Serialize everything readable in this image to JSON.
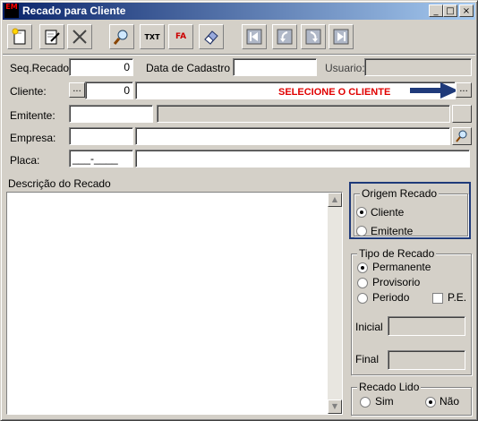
{
  "window": {
    "title": "Recado para Cliente",
    "icon_text": "EM",
    "minimize_label": "_",
    "maximize_label": "□",
    "close_label": "×"
  },
  "toolbar": {
    "icons": [
      "new-icon",
      "edit-icon",
      "delete-icon",
      "search-icon",
      "txt-export-icon",
      "font-icon",
      "erase-icon",
      "first-record-icon",
      "previous-record-icon",
      "next-record-icon",
      "last-record-icon"
    ],
    "txt_label": "TXT",
    "font_label": "FA"
  },
  "form": {
    "seq_label": "Seq.Recado",
    "seq_value": "0",
    "data_cadastro_label": "Data de Cadastro :",
    "data_cadastro_value": "",
    "usuario_label": "Usuario:",
    "usuario_value": "",
    "cliente_label": "Cliente:",
    "cliente_browse": "...",
    "cliente_code": "0",
    "cliente_name": "",
    "cliente_lookup": "...",
    "hint_text": "SELECIONE O CLIENTE",
    "emitente_label": "Emitente:",
    "emitente_code": "",
    "emitente_name": "",
    "empresa_label": "Empresa:",
    "empresa_code": "",
    "empresa_name": "",
    "placa_label": "Placa:",
    "placa_value": "___-____",
    "placa_desc": "",
    "descricao_label": "Descrição do Recado",
    "descricao_value": ""
  },
  "origem": {
    "title": "Origem Recado",
    "options": [
      "Cliente",
      "Emitente"
    ],
    "selected": "Cliente"
  },
  "tipo": {
    "title": "Tipo de Recado",
    "options": [
      "Permanente",
      "Provisorio",
      "Periodo"
    ],
    "selected": "Permanente",
    "pe_label": "P.E.",
    "pe_checked": false,
    "inicial_label": "Inicial",
    "inicial_value": "",
    "final_label": "Final",
    "final_value": ""
  },
  "lido": {
    "title": "Recado Lido",
    "options": [
      "Sim",
      "Não"
    ],
    "selected": "Não"
  },
  "colors": {
    "title_start": "#0a246a",
    "title_end": "#a6caf0",
    "hint": "#e00000",
    "arrow": "#1f3a7a",
    "highlight_border": "#1f3a7a"
  }
}
